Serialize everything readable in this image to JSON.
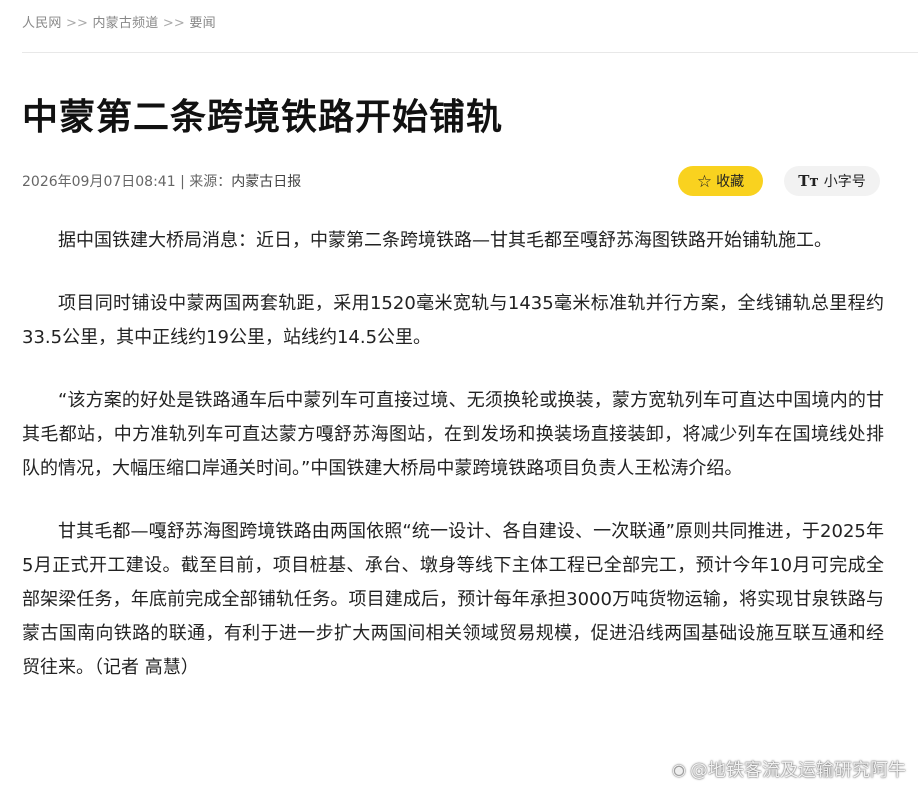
{
  "breadcrumb": {
    "items": [
      "人民网",
      "内蒙古频道",
      "要闻"
    ],
    "separator": ">>"
  },
  "article": {
    "title": "中蒙第二条跨境铁路开始铺轨",
    "datetime": "2026年09月07日08:41",
    "source_label": "来源：",
    "source_name": "内蒙古日报",
    "paragraphs": [
      "据中国铁建大桥局消息：近日，中蒙第二条跨境铁路—甘其毛都至嘎舒苏海图铁路开始铺轨施工。",
      "项目同时铺设中蒙两国两套轨距，采用1520毫米宽轨与1435毫米标准轨并行方案，全线铺轨总里程约33.5公里，其中正线约19公里，站线约14.5公里。",
      "“该方案的好处是铁路通车后中蒙列车可直接过境、无须换轮或换装，蒙方宽轨列车可直达中国境内的甘其毛都站，中方准轨列车可直达蒙方嘎舒苏海图站，在到发场和换装场直接装卸，将减少列车在国境线处排队的情况，大幅压缩口岸通关时间。”中国铁建大桥局中蒙跨境铁路项目负责人王松涛介绍。",
      "甘其毛都—嘎舒苏海图跨境铁路由两国依照“统一设计、各自建设、一次联通”原则共同推进，于2025年5月正式开工建设。截至目前，项目桩基、承台、墩身等线下主体工程已全部完工，预计今年10月可完成全部架梁任务，年底前完成全部铺轨任务。项目建成后，预计每年承担3000万吨货物运输，将实现甘泉铁路与蒙古国南向铁路的联通，有利于进一步扩大两国间相关领域贸易规模，促进沿线两国基础设施互联互通和经贸往来。（记者 高慧）"
    ]
  },
  "toolbar": {
    "favorite_label": "收藏",
    "font_size_label": "小字号",
    "font_icon_text": "Tт"
  },
  "watermark": {
    "text": "@地铁客流及运输研究阿牛"
  },
  "colors": {
    "favorite_bg": "#f9d21f",
    "font_btn_bg": "#f2f2f2"
  },
  "icons": {
    "favorite": "star-outline-icon",
    "font_size": "font-size-icon",
    "watermark": "weibo-icon"
  }
}
